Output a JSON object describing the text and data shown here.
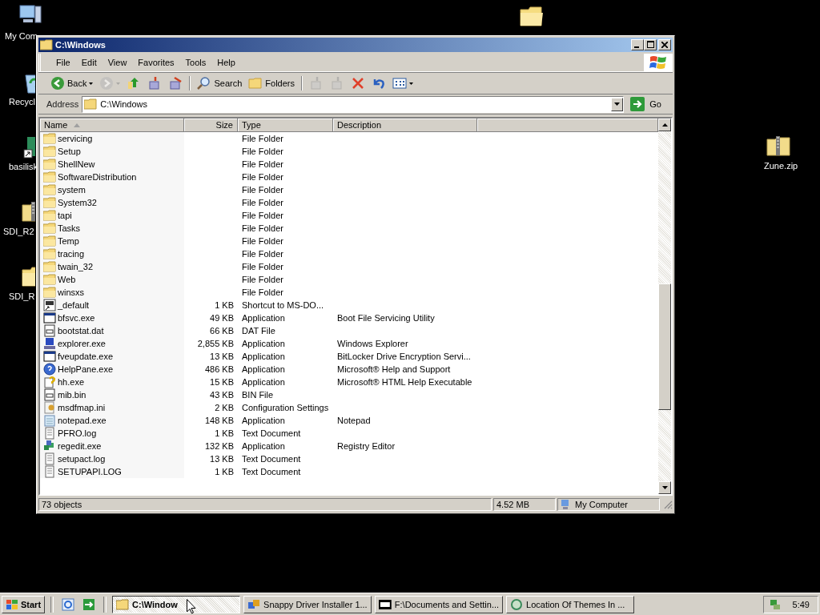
{
  "desktop": {
    "icons": [
      {
        "kind": "computer",
        "label": "My Com"
      },
      {
        "kind": "recycle",
        "label": "Recycl"
      },
      {
        "kind": "shortcut",
        "label": "basilisk"
      },
      {
        "kind": "zip",
        "label": "SDI_R2"
      },
      {
        "kind": "folder",
        "label": "SDI_R"
      },
      {
        "kind": "folder"
      },
      {
        "kind": "zip",
        "label": "Zune.zip"
      }
    ]
  },
  "window": {
    "title": "C:\\Windows",
    "menu": [
      "File",
      "Edit",
      "View",
      "Favorites",
      "Tools",
      "Help"
    ],
    "toolbar": [
      {
        "kind": "back",
        "label": "Back",
        "disabled": false
      },
      {
        "kind": "forward",
        "disabled": true
      },
      {
        "kind": "up",
        "disabled": false
      },
      {
        "kind": "move",
        "disabled": false
      },
      {
        "kind": "copy",
        "disabled": false
      },
      {
        "kind": "search",
        "label": "Search",
        "disabled": false
      },
      {
        "kind": "folders",
        "label": "Folders",
        "disabled": false
      },
      {
        "kind": "moveto",
        "disabled": true
      },
      {
        "kind": "copyto",
        "disabled": true
      },
      {
        "kind": "delete",
        "disabled": false
      },
      {
        "kind": "undo",
        "disabled": false
      },
      {
        "kind": "views",
        "disabled": false
      }
    ],
    "address": {
      "label": "Address",
      "value": "C:\\Windows",
      "go": "Go"
    },
    "columns": [
      {
        "label": "Name",
        "sorted": true
      },
      {
        "label": "Size",
        "sorted": false
      },
      {
        "label": "Type",
        "sorted": false
      },
      {
        "label": "Description",
        "sorted": false
      }
    ],
    "rows": [
      {
        "kind": "folder",
        "name": "servicing",
        "type": "File Folder"
      },
      {
        "kind": "folder",
        "name": "Setup",
        "type": "File Folder"
      },
      {
        "kind": "folder",
        "name": "ShellNew",
        "type": "File Folder"
      },
      {
        "kind": "folder",
        "name": "SoftwareDistribution",
        "type": "File Folder"
      },
      {
        "kind": "folder",
        "name": "system",
        "type": "File Folder"
      },
      {
        "kind": "folder",
        "name": "System32",
        "type": "File Folder"
      },
      {
        "kind": "folder",
        "name": "tapi",
        "type": "File Folder"
      },
      {
        "kind": "folder",
        "name": "Tasks",
        "type": "File Folder"
      },
      {
        "kind": "folder",
        "name": "Temp",
        "type": "File Folder"
      },
      {
        "kind": "folder",
        "name": "tracing",
        "type": "File Folder"
      },
      {
        "kind": "folder",
        "name": "twain_32",
        "type": "File Folder"
      },
      {
        "kind": "folder",
        "name": "Web",
        "type": "File Folder"
      },
      {
        "kind": "folder",
        "name": "winsxs",
        "type": "File Folder"
      },
      {
        "kind": "shortcut",
        "name": "_default",
        "size": "1 KB",
        "type": "Shortcut to MS-DO..."
      },
      {
        "kind": "app",
        "name": "bfsvc.exe",
        "size": "49 KB",
        "type": "Application",
        "description": "Boot File Servicing Utility"
      },
      {
        "kind": "data",
        "name": "bootstat.dat",
        "size": "66 KB",
        "type": "DAT File"
      },
      {
        "kind": "explorer",
        "name": "explorer.exe",
        "size": "2,855 KB",
        "type": "Application",
        "description": "Windows Explorer"
      },
      {
        "kind": "app",
        "name": "fveupdate.exe",
        "size": "13 KB",
        "type": "Application",
        "description": "BitLocker Drive Encryption Servi..."
      },
      {
        "kind": "help",
        "name": "HelpPane.exe",
        "size": "486 KB",
        "type": "Application",
        "description": "Microsoft® Help and Support"
      },
      {
        "kind": "helpfile",
        "name": "hh.exe",
        "size": "15 KB",
        "type": "Application",
        "description": "Microsoft® HTML Help Executable"
      },
      {
        "kind": "data",
        "name": "mib.bin",
        "size": "43 KB",
        "type": "BIN File"
      },
      {
        "kind": "settings",
        "name": "msdfmap.ini",
        "size": "2 KB",
        "type": "Configuration Settings"
      },
      {
        "kind": "notepad",
        "name": "notepad.exe",
        "size": "148 KB",
        "type": "Application",
        "description": "Notepad"
      },
      {
        "kind": "text",
        "name": "PFRO.log",
        "size": "1 KB",
        "type": "Text Document"
      },
      {
        "kind": "registry",
        "name": "regedit.exe",
        "size": "132 KB",
        "type": "Application",
        "description": "Registry Editor"
      },
      {
        "kind": "text",
        "name": "setupact.log",
        "size": "13 KB",
        "type": "Text Document"
      },
      {
        "kind": "text",
        "name": "SETUPAPI.LOG",
        "size": "1 KB",
        "type": "Text Document"
      }
    ],
    "status": {
      "count": "73 objects",
      "size": "4.52 MB",
      "zone": "My Computer"
    }
  },
  "taskbar": {
    "start": "Start",
    "quick_launch": [
      {
        "kind": "browser"
      },
      {
        "kind": "desktop"
      }
    ],
    "tasks": [
      {
        "kind": "folder",
        "label": "C:\\Window",
        "selected": true
      },
      {
        "kind": "installer",
        "label": "Snappy Driver Installer 1...",
        "selected": false
      },
      {
        "kind": "archive",
        "label": "F:\\Documents and Settin...",
        "selected": false
      },
      {
        "kind": "web",
        "label": "Location Of Themes In ...",
        "selected": false
      }
    ],
    "clock": "5:49"
  }
}
